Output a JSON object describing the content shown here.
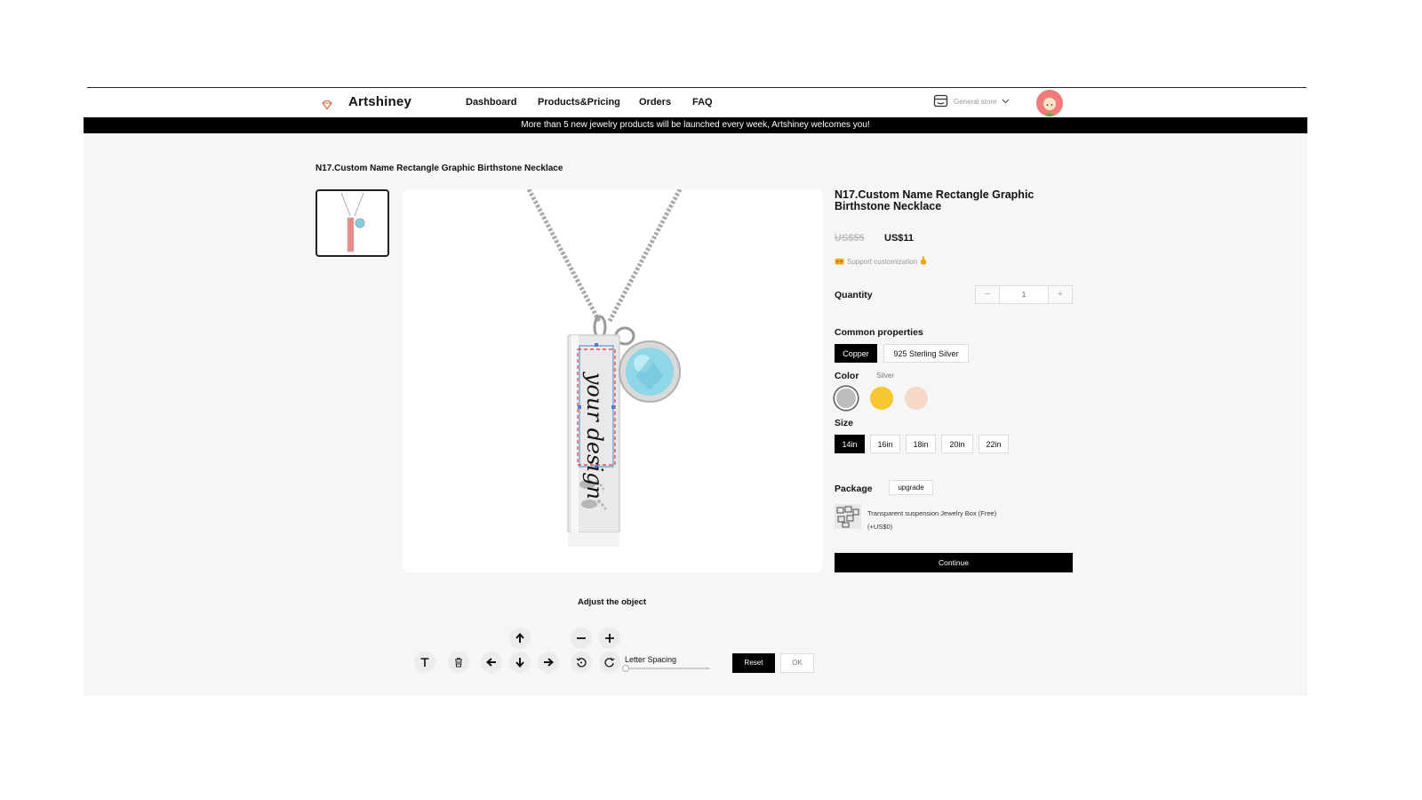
{
  "nav": {
    "brand": "Artshiney",
    "menu": [
      "Dashboard",
      "Products&Pricing",
      "Orders",
      "FAQ"
    ],
    "store_label": "General store"
  },
  "banner": "More than 5 new jewelry products will be launched every week, Artshiney welcomes you!",
  "breadcrumb": "N17.Custom Name Rectangle Graphic Birthstone Necklace",
  "preview": {
    "engraving_text": "your design"
  },
  "product": {
    "title": "N17.Custom Name Rectangle Graphic Birthstone Necklace",
    "price_old": "US$55",
    "price_new": "US$11",
    "support": "Support customization",
    "quantity_label": "Quantity",
    "quantity": "1",
    "minus": "−",
    "plus": "+",
    "material_label": "Common properties",
    "materials": [
      "Copper",
      "925 Sterling Silver"
    ],
    "color_label": "Color",
    "color_selected": "Silver",
    "colors": [
      "#bdbdbd",
      "#f5c832",
      "#f6d9c4"
    ],
    "size_label": "Size",
    "sizes": [
      "14in",
      "16in",
      "18in",
      "20in",
      "22in"
    ],
    "package_label": "Package",
    "package_upgrade": "upgrade",
    "package_name": "Transparent suspension Jewelry Box (Free)",
    "package_price": "(+US$0)",
    "continue": "Continue"
  },
  "editor": {
    "heading": "Adjust the object",
    "letter_spacing_label": "Letter Spacing",
    "letter_spacing_value": 0,
    "reset": "Reset",
    "ok": "OK"
  }
}
